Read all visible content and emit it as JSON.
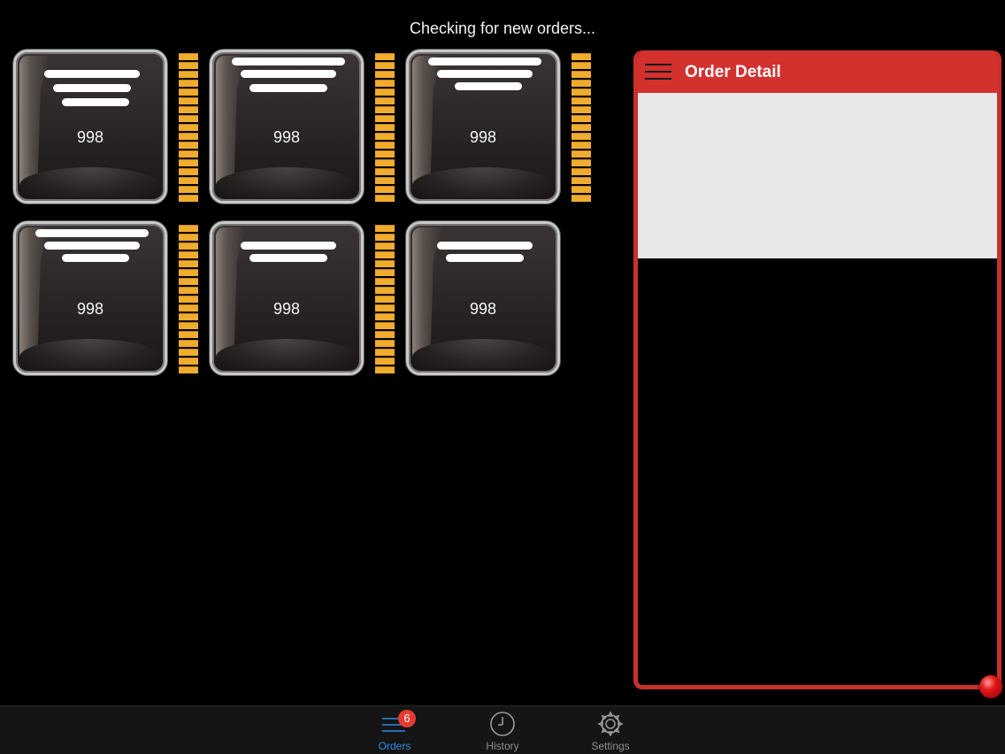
{
  "status_text": "Checking for new orders...",
  "orders": [
    {
      "number": "998"
    },
    {
      "number": "998"
    },
    {
      "number": "998"
    },
    {
      "number": "998"
    },
    {
      "number": "998"
    },
    {
      "number": "998"
    }
  ],
  "detail_panel": {
    "title": "Order Detail",
    "menu_icon": "hamburger-menu-icon",
    "accent_color": "#d2312e"
  },
  "tabbar": {
    "tabs": [
      {
        "label": "Orders",
        "icon": "list-lines-icon",
        "badge": "6",
        "active": true
      },
      {
        "label": "History",
        "icon": "clock-icon",
        "active": false
      },
      {
        "label": "Settings",
        "icon": "gear-icon",
        "active": false
      }
    ],
    "active_color": "#2f8ae4",
    "badge_color": "#e53a2f"
  },
  "colors": {
    "ladder": "#f0ac2e"
  }
}
